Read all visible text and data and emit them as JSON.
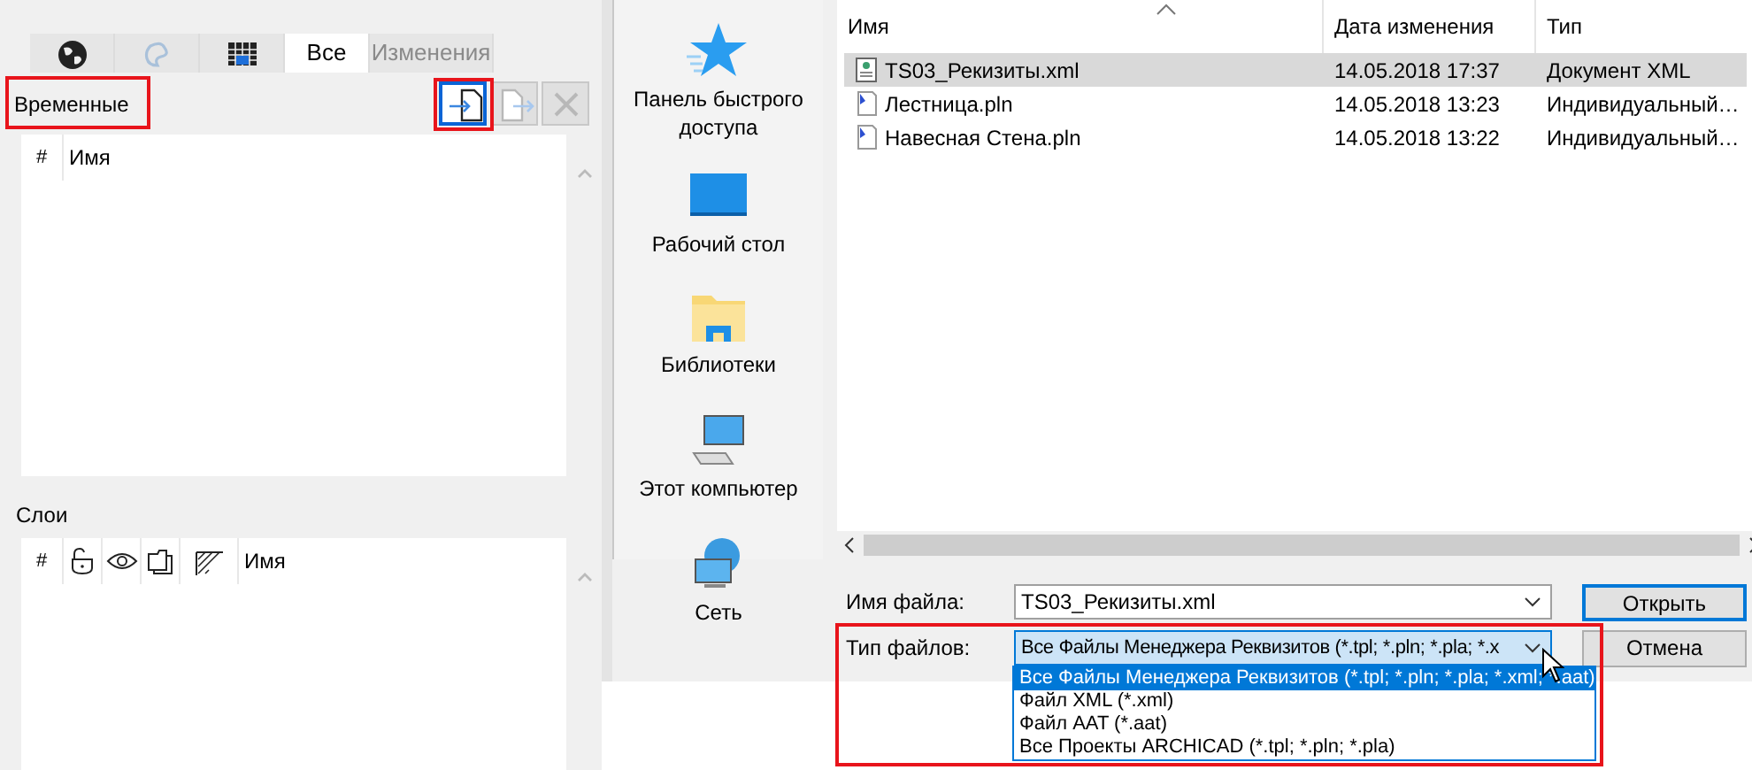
{
  "left_panel": {
    "tabs": [
      {
        "kind": "globe",
        "selected": false,
        "disabled": false
      },
      {
        "kind": "swirl",
        "selected": false,
        "disabled": true
      },
      {
        "kind": "grid",
        "selected": false,
        "disabled": false
      },
      {
        "kind": "text",
        "label": "Все",
        "selected": true,
        "disabled": false
      },
      {
        "kind": "text",
        "label": "Изменения",
        "selected": false,
        "disabled": true
      }
    ],
    "section_title": "Временные",
    "toolbar": [
      {
        "kind": "import",
        "disabled": false,
        "focused": true
      },
      {
        "kind": "export",
        "disabled": true,
        "focused": false
      },
      {
        "kind": "delete",
        "disabled": true,
        "focused": false
      }
    ],
    "table": {
      "columns": [
        {
          "kind": "text",
          "label": "#"
        },
        {
          "kind": "text",
          "label": "Имя"
        }
      ]
    },
    "layers_title": "Слои",
    "layers_table": {
      "columns": [
        {
          "kind": "text",
          "label": "#"
        },
        {
          "kind": "lock"
        },
        {
          "kind": "eye"
        },
        {
          "kind": "pages"
        },
        {
          "kind": "hatch"
        },
        {
          "kind": "text",
          "label": "Имя"
        }
      ]
    }
  },
  "dialog": {
    "nav": [
      {
        "kind": "star",
        "label": "Панель быстрого доступа"
      },
      {
        "kind": "desktop",
        "label": "Рабочий стол"
      },
      {
        "kind": "folder",
        "label": "Библиотеки"
      },
      {
        "kind": "computer",
        "label": "Этот компьютер"
      },
      {
        "kind": "network",
        "label": "Сеть"
      }
    ],
    "files": {
      "columns": [
        "Имя",
        "Дата изменения",
        "Тип"
      ],
      "rows": [
        {
          "kind": "xml",
          "name": "TS03_Рекизиты.xml",
          "date": "14.05.2018 17:37",
          "type": "Документ XML",
          "selected": true
        },
        {
          "kind": "pln",
          "name": "Лестница.pln",
          "date": "14.05.2018 13:23",
          "type": "Индивидуальный…",
          "selected": false
        },
        {
          "kind": "pln",
          "name": "Навесная Стена.pln",
          "date": "14.05.2018 13:22",
          "type": "Индивидуальный…",
          "selected": false
        }
      ]
    },
    "filename": {
      "label": "Имя файла:",
      "value": "TS03_Рекизиты.xml"
    },
    "filetype": {
      "label": "Тип файлов:",
      "value": "Все Файлы Менеджера Реквизитов (*.tpl; *.pln; *.pla; *.x",
      "expanded": true,
      "options": [
        {
          "label": "Все Файлы Менеджера Реквизитов (*.tpl; *.pln; *.pla; *.xml; *.aat)",
          "selected": true
        },
        {
          "label": "Файл XML (*.xml)",
          "selected": false
        },
        {
          "label": "Файл AAT (*.aat)",
          "selected": false
        },
        {
          "label": "Все Проекты ARCHICAD (*.tpl; *.pln; *.pla)",
          "selected": false
        }
      ]
    },
    "buttons": [
      {
        "label": "Открыть",
        "default": true
      },
      {
        "label": "Отмена",
        "default": false
      }
    ]
  }
}
